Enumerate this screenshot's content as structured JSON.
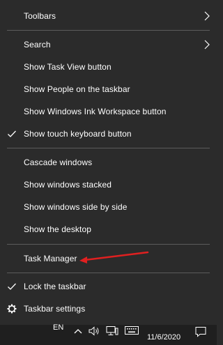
{
  "context_menu": {
    "items": [
      {
        "label": "Toolbars",
        "submenu": true,
        "checked": false
      },
      {
        "label": "Search",
        "submenu": true,
        "checked": false
      },
      {
        "label": "Show Task View button",
        "submenu": false,
        "checked": false
      },
      {
        "label": "Show People on the taskbar",
        "submenu": false,
        "checked": false
      },
      {
        "label": "Show Windows Ink Workspace button",
        "submenu": false,
        "checked": false
      },
      {
        "label": "Show touch keyboard button",
        "submenu": false,
        "checked": true
      },
      {
        "label": "Cascade windows",
        "submenu": false,
        "checked": false
      },
      {
        "label": "Show windows stacked",
        "submenu": false,
        "checked": false
      },
      {
        "label": "Show windows side by side",
        "submenu": false,
        "checked": false
      },
      {
        "label": "Show the desktop",
        "submenu": false,
        "checked": false
      },
      {
        "label": "Task Manager",
        "submenu": false,
        "checked": false
      },
      {
        "label": "Lock the taskbar",
        "submenu": false,
        "checked": true
      },
      {
        "label": "Taskbar settings",
        "submenu": false,
        "checked": false,
        "icon": "gear-icon"
      }
    ]
  },
  "annotation": {
    "color": "#e02020",
    "points_to": "Task Manager"
  },
  "taskbar": {
    "language": "EN",
    "date": "11/6/2020",
    "icons": [
      "chevron-up-icon",
      "speaker-icon",
      "network-icon",
      "keyboard-icon",
      "notification-icon"
    ]
  },
  "colors": {
    "menu_bg": "#2b2b2b",
    "separator": "#5c5c5c",
    "text": "#ffffff",
    "taskbar_bg": "#1f1f1f"
  }
}
